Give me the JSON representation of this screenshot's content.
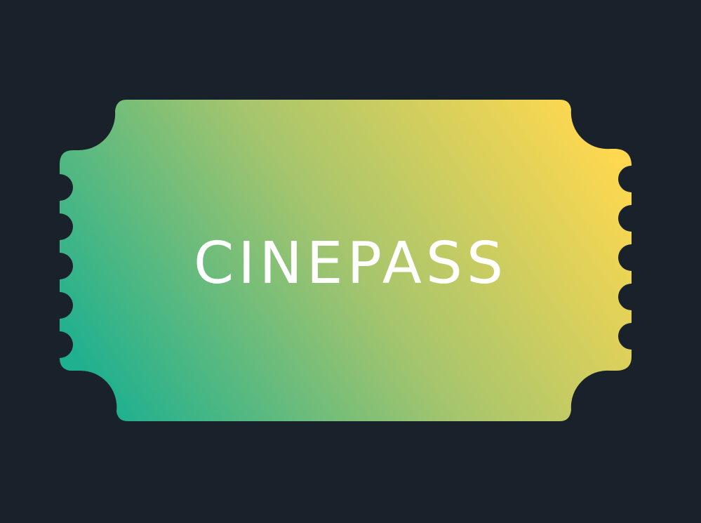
{
  "logo": {
    "text": "CINEPASS",
    "icon": "ticket-icon",
    "colors": {
      "background": "#19222b",
      "gradient_start": "#1fb08f",
      "gradient_end": "#ffd84f",
      "text": "#ffffff"
    }
  }
}
